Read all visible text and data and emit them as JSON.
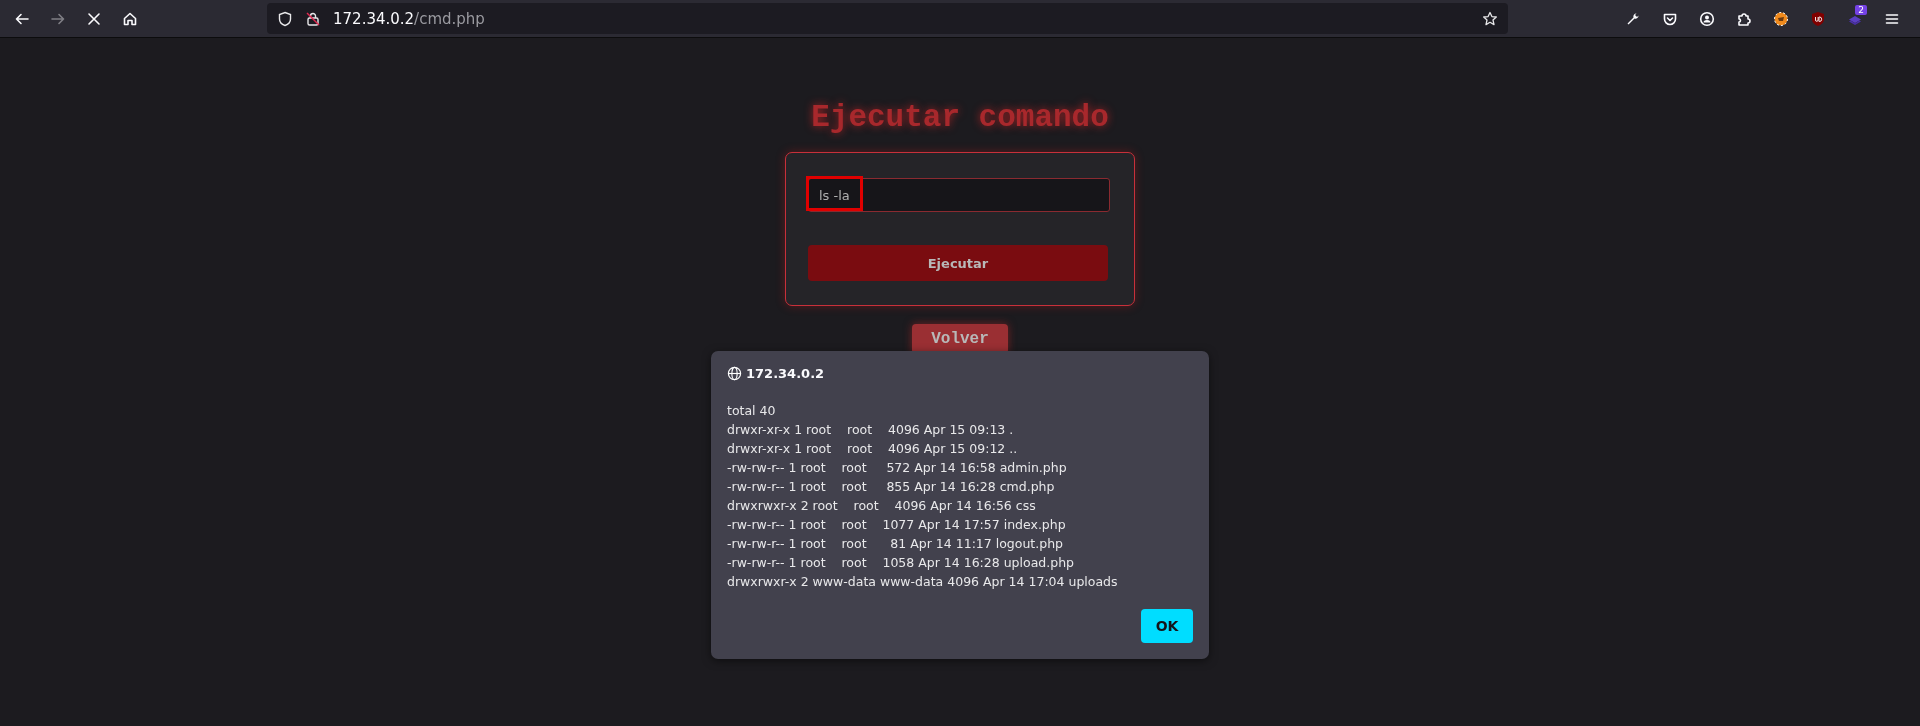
{
  "toolbar": {
    "nav_buttons": [
      {
        "kind": "back",
        "disabled": false
      },
      {
        "kind": "forward",
        "disabled": true
      },
      {
        "kind": "stop",
        "disabled": false
      },
      {
        "kind": "home",
        "disabled": false
      }
    ],
    "url": {
      "host": "172.34.0.2",
      "path": "/cmd.php"
    },
    "extensions": [
      {
        "kind": "wrench"
      },
      {
        "kind": "pocket"
      },
      {
        "kind": "account"
      },
      {
        "kind": "puzzle"
      },
      {
        "kind": "addon-round"
      },
      {
        "kind": "shield-addon"
      },
      {
        "kind": "layers",
        "badge": "2"
      },
      {
        "kind": "menu"
      }
    ]
  },
  "page": {
    "title": "Ejecutar comando",
    "command_field": {
      "value": "ls -la",
      "highlighted": true
    },
    "submit_button": "Ejecutar",
    "back_button": "Volver"
  },
  "dialog": {
    "origin": "172.34.0.2",
    "lines": [
      "total 40",
      "drwxr-xr-x 1 root    root    4096 Apr 15 09:13 .",
      "drwxr-xr-x 1 root    root    4096 Apr 15 09:12 ..",
      "-rw-rw-r-- 1 root    root     572 Apr 14 16:58 admin.php",
      "-rw-rw-r-- 1 root    root     855 Apr 14 16:28 cmd.php",
      "drwxrwxr-x 2 root    root    4096 Apr 14 16:56 css",
      "-rw-rw-r-- 1 root    root    1077 Apr 14 17:57 index.php",
      "-rw-rw-r-- 1 root    root      81 Apr 14 11:17 logout.php",
      "-rw-rw-r-- 1 root    root    1058 Apr 14 16:28 upload.php",
      "drwxrwxr-x 2 www-data www-data 4096 Apr 14 17:04 uploads"
    ],
    "ok_button": "OK"
  }
}
